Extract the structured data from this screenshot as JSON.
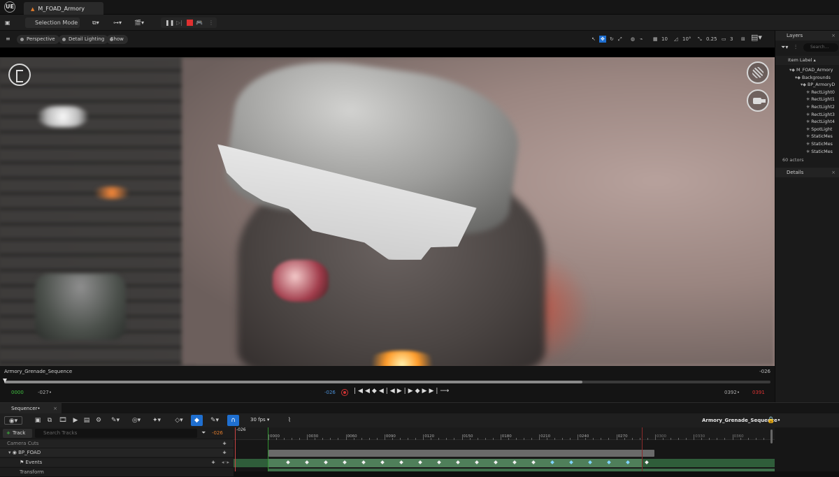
{
  "titlebar": {
    "tab_title": "M_FOAD_Armory",
    "logo": "UE"
  },
  "toolbar": {
    "selection_mode": "Selection Mode"
  },
  "viewport_bar": {
    "perspective": "Perspective",
    "lighting": "Detail Lighting",
    "show": "Show",
    "grid_snap": "10",
    "rot_snap": "10°",
    "scale_snap": "0.25",
    "cam_speed": "3"
  },
  "transport": {
    "sequence_name": "Armory_Grenade_Sequence",
    "end_frame_top": "-026",
    "start": "0000",
    "in_point": "-027•",
    "current": "-026",
    "out_point": "0392•",
    "end": "0391",
    "progress": 0.755
  },
  "layers": {
    "tab": "Layers",
    "search_placeholder": "Search...",
    "header": "Item Label ▴",
    "items": [
      {
        "label": "M_FOAD_Armory",
        "indent": 1
      },
      {
        "label": "Backgrounds",
        "indent": 2
      },
      {
        "label": "BP_ArmoryD",
        "indent": 3
      },
      {
        "label": "RectLight0",
        "indent": 4
      },
      {
        "label": "RectLight1",
        "indent": 4
      },
      {
        "label": "RectLight2",
        "indent": 4
      },
      {
        "label": "RectLight3",
        "indent": 4
      },
      {
        "label": "RectLight4",
        "indent": 4
      },
      {
        "label": "SpotLight",
        "indent": 4
      },
      {
        "label": "StaticMes",
        "indent": 4
      },
      {
        "label": "StaticMes",
        "indent": 4
      },
      {
        "label": "StaticMes",
        "indent": 4
      }
    ],
    "actor_count": "60 actors"
  },
  "details": {
    "tab": "Details"
  },
  "sequencer": {
    "tab": "Sequencer•",
    "fps": "30 fps",
    "title": "Armory_Grenade_Sequence•",
    "add_track": "Track",
    "search_placeholder": "Search Tracks",
    "current_frame": "-026",
    "tracks": {
      "camera_cuts": "Camera Cuts",
      "bp_foad": "BP_FOAD",
      "events": "Events",
      "transform": "Transform"
    },
    "ruler_labels": [
      "0000",
      "0030",
      "0060",
      "0090",
      "0120",
      "0150",
      "0180",
      "0210",
      "0240",
      "0270",
      "0300",
      "0330",
      "0360"
    ]
  },
  "colors": {
    "accent": "#1f6fd0",
    "start_green": "#3fbf3f",
    "end_red": "#d33333",
    "orange": "#e07b2c"
  }
}
